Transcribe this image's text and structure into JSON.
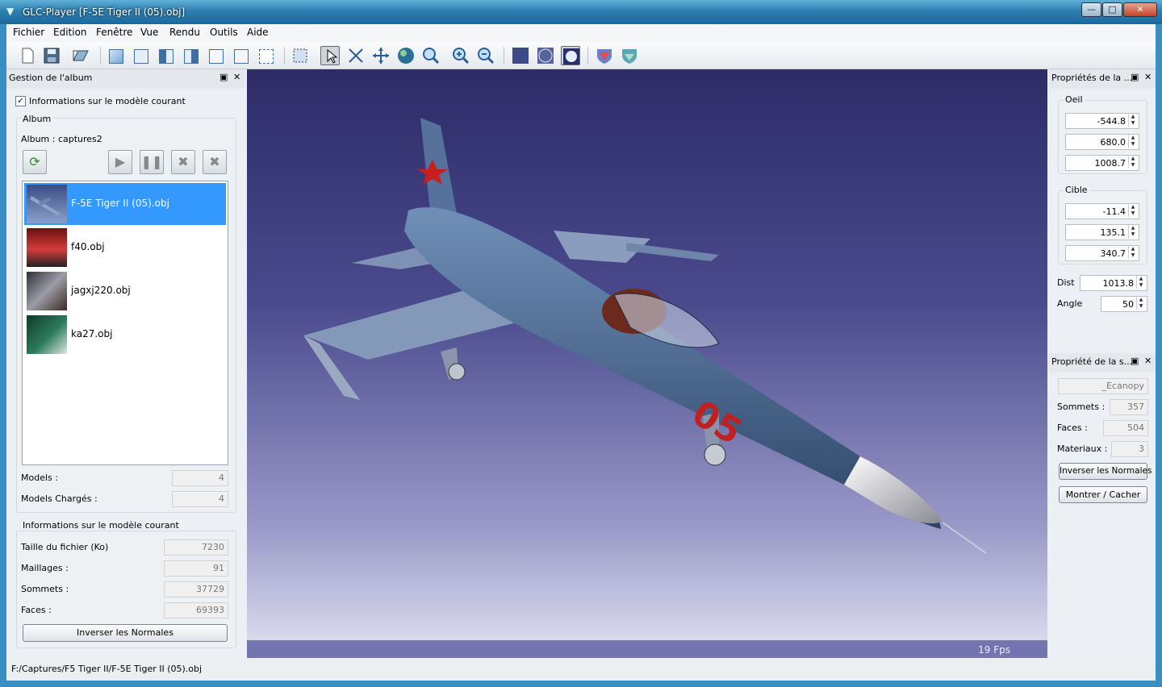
{
  "window": {
    "title": "GLC-Player [F-5E Tiger II (05).obj]",
    "min_glyph": "—",
    "max_glyph": "□",
    "close_glyph": "✕"
  },
  "menu": [
    {
      "label": "Fichier"
    },
    {
      "label": "Edition"
    },
    {
      "label": "Fenêtre"
    },
    {
      "label": "Vue"
    },
    {
      "label": "Rendu"
    },
    {
      "label": "Outils"
    },
    {
      "label": "Aide"
    }
  ],
  "album_panel": {
    "title": "Gestion de l'album",
    "show_info_checkbox": "Informations sur le modèle courant",
    "album_group": "Album",
    "album_name": "Album : captures2",
    "items": [
      {
        "name": "F-5E Tiger II (05).obj",
        "selected": true
      },
      {
        "name": "f40.obj"
      },
      {
        "name": "jagxj220.obj"
      },
      {
        "name": "ka27.obj"
      }
    ],
    "models_label": "Models :",
    "models_value": "4",
    "loaded_label": "Models Chargés :",
    "loaded_value": "4"
  },
  "model_info": {
    "group_title": "Informations sur le modèle courant",
    "filesize_label": "Taille du fichier (Ko)",
    "filesize_value": "7230",
    "meshes_label": "Maillages :",
    "meshes_value": "91",
    "vertices_label": "Sommets :",
    "vertices_value": "37729",
    "faces_label": "Faces :",
    "faces_value": "69393",
    "invert_button": "Inverser les Normales"
  },
  "camera_panel": {
    "title": "Propriétés de la ...",
    "eye_group": "Oeil",
    "eye": [
      "-544.8",
      "680.0",
      "1008.7"
    ],
    "target_group": "Cible",
    "target": [
      "-11.4",
      "135.1",
      "340.7"
    ],
    "dist_label": "Dist",
    "dist_value": "1013.8",
    "angle_label": "Angle",
    "angle_value": "50"
  },
  "selection_panel": {
    "title": "Propriété de la s...",
    "name_value": "_Ecanopy",
    "vertices_label": "Sommets :",
    "vertices_value": "357",
    "faces_label": "Faces :",
    "faces_value": "504",
    "materials_label": "Materiaux :",
    "materials_value": "3",
    "invert_button": "Inverser les Normales",
    "toggle_button": "Montrer / Cacher"
  },
  "viewport": {
    "fps": "19 Fps",
    "livery_number": "05"
  },
  "status": {
    "path": "F:/Captures/F5 Tiger II/F-5E Tiger II (05).obj"
  },
  "colors": {
    "selection": "#3399ff",
    "title_bar": "#2f7fb1"
  }
}
